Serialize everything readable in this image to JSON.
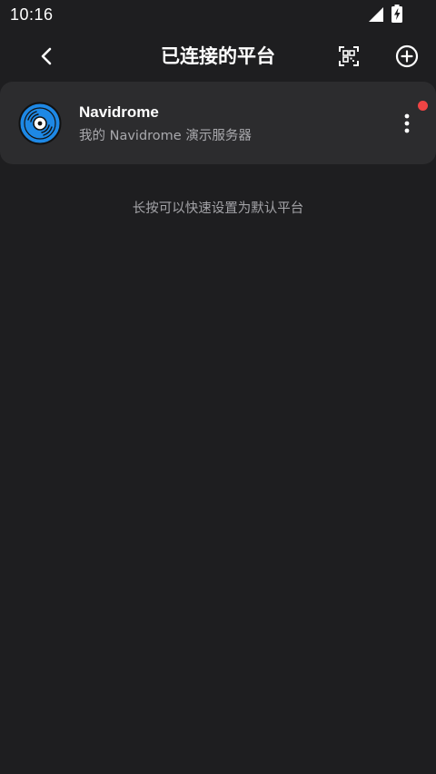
{
  "status_bar": {
    "time": "10:16",
    "icons": [
      "signal-icon",
      "battery-charging-icon"
    ]
  },
  "app_bar": {
    "title": "已连接的平台",
    "back_icon": "chevron-left-icon",
    "scan_icon": "qr-scan-icon",
    "add_icon": "add-circle-icon"
  },
  "servers": [
    {
      "name": "Navidrome",
      "description": "我的 Navidrome 演示服务器",
      "icon": "vinyl-record-icon",
      "status_color": "#ef4444"
    }
  ],
  "hint": "长按可以快速设置为默认平台",
  "colors": {
    "background": "#1e1e20",
    "card": "#2c2c2e",
    "accent": "#1e88e5",
    "status_dot": "#ef4444"
  }
}
